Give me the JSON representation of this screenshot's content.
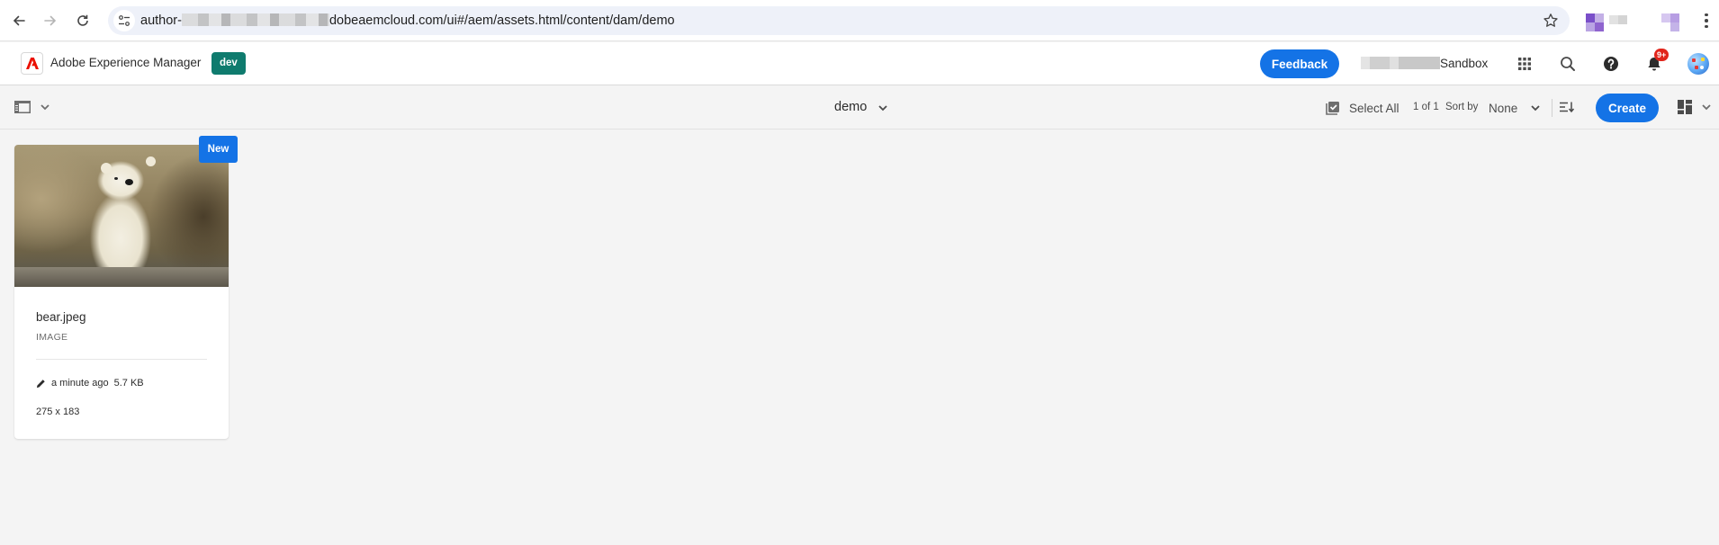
{
  "browser": {
    "url_prefix": "author-",
    "url_suffix": "dobeaemcloud.com/ui#/aem/assets.html/content/dam/demo",
    "icons": {
      "back": "arrow-left-icon",
      "forward": "arrow-right-icon",
      "reload": "reload-icon",
      "site_info": "tune-icon",
      "bookmark": "star-icon",
      "menu": "kebab-menu-icon"
    }
  },
  "header": {
    "app_name": "Adobe Experience Manager",
    "env_badge": "dev",
    "feedback_label": "Feedback",
    "org_suffix": "Sandbox",
    "notification_count": "9+",
    "icons": {
      "logo": "adobe-logo-icon",
      "apps": "grid-dots-icon",
      "search": "search-icon",
      "help": "help-icon",
      "notifications": "bell-icon",
      "avatar": "user-avatar"
    },
    "brand_color": "#1473e6",
    "env_color": "#0f7b6e"
  },
  "action_bar": {
    "folder_title": "demo",
    "select_all_label": "Select All",
    "page_count": "1 of 1",
    "sort_by_label": "Sort by",
    "sort_value": "None",
    "create_label": "Create"
  },
  "assets": [
    {
      "badge": "New",
      "name": "bear.jpeg",
      "type": "IMAGE",
      "modified": "a minute ago",
      "size": "5.7 KB",
      "dimensions": "275 x 183"
    }
  ]
}
